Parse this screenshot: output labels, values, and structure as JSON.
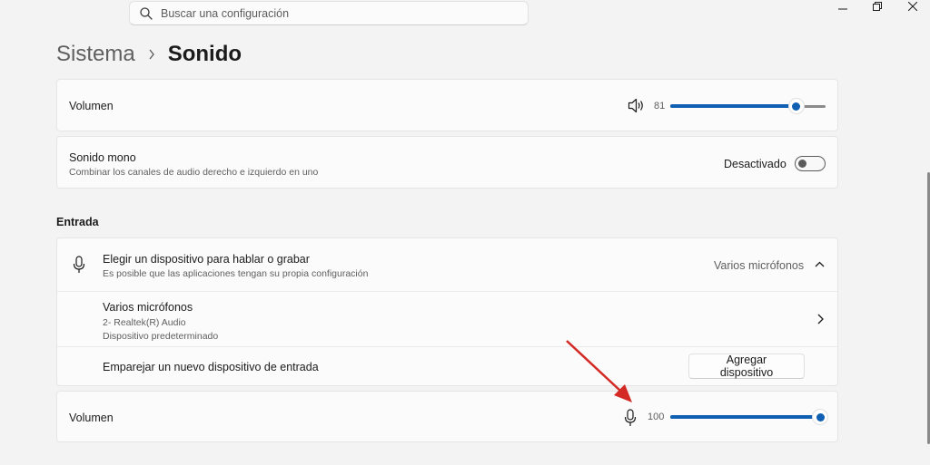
{
  "search": {
    "placeholder": "Buscar una configuración"
  },
  "breadcrumb": {
    "parent": "Sistema",
    "current": "Sonido"
  },
  "output": {
    "volume_label": "Volumen",
    "volume_value": "81",
    "volume_level_percent": 81,
    "mono": {
      "title": "Sonido mono",
      "subtitle": "Combinar los canales de audio derecho e izquierdo en uno",
      "state_label": "Desactivado",
      "enabled": false
    }
  },
  "input_section": {
    "header": "Entrada",
    "chooser": {
      "title": "Elegir un dispositivo para hablar o grabar",
      "subtitle": "Es posible que las aplicaciones tengan su propia configuración",
      "selected": "Varios micrófonos"
    },
    "device": {
      "name": "Varios micrófonos",
      "line1": "2- Realtek(R) Audio",
      "line2": "Dispositivo predeterminado"
    },
    "pair": {
      "label": "Emparejar un nuevo dispositivo de entrada",
      "button": "Agregar dispositivo"
    },
    "volume_label": "Volumen",
    "volume_value": "100",
    "volume_level_percent": 100
  },
  "colors": {
    "accent": "#0f5fb3",
    "annotation_arrow": "#d42a25"
  },
  "icons": [
    "search-icon",
    "minimize-icon",
    "restore-icon",
    "close-icon",
    "speaker-icon",
    "microphone-icon",
    "chevron-up-icon",
    "chevron-right-icon"
  ]
}
